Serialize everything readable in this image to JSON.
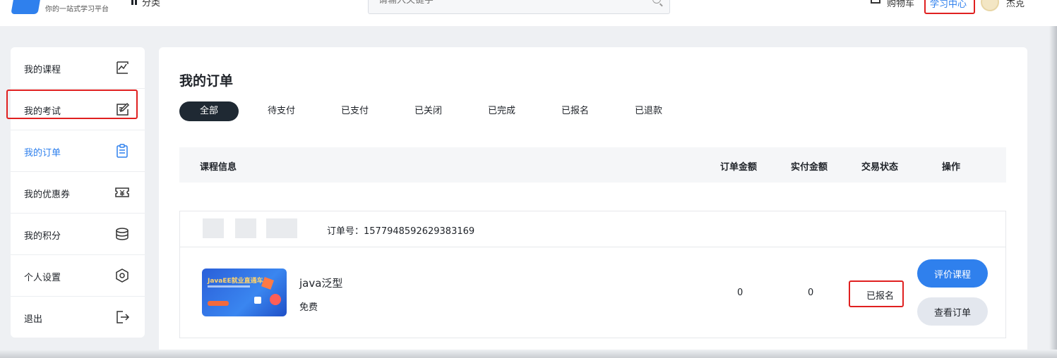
{
  "header": {
    "logo_tagline": "你的一站式学习平台",
    "category_label": "分类",
    "search_placeholder": "请输入关键字",
    "cart_label": "购物车",
    "study_center_label": "学习中心",
    "username": "杰克"
  },
  "sidebar": {
    "items": [
      {
        "label": "我的课程",
        "icon": "chart-icon"
      },
      {
        "label": "我的考试",
        "icon": "edit-icon"
      },
      {
        "label": "我的订单",
        "icon": "clipboard-icon"
      },
      {
        "label": "我的优惠券",
        "icon": "coupon-icon"
      },
      {
        "label": "我的积分",
        "icon": "coins-icon"
      },
      {
        "label": "个人设置",
        "icon": "settings-icon"
      },
      {
        "label": "退出",
        "icon": "logout-icon"
      }
    ],
    "active_index": 2
  },
  "main": {
    "title": "我的订单",
    "tabs": [
      "全部",
      "待支付",
      "已支付",
      "已关闭",
      "已完成",
      "已报名",
      "已退款"
    ],
    "active_tab": 0,
    "table_headers": {
      "course_info": "课程信息",
      "order_amount": "订单金额",
      "paid_amount": "实付金额",
      "trade_status": "交易状态",
      "actions": "操作"
    },
    "orders": [
      {
        "order_no_label": "订单号：1577948592629383169",
        "thumbnail_text": "JavaEE就业直通车",
        "course_name": "java泛型",
        "price_label": "免费",
        "order_amount": "0",
        "paid_amount": "0",
        "status": "已报名",
        "review_button": "评价课程",
        "view_button": "查看订单"
      }
    ]
  },
  "colors": {
    "accent": "#2f80ed",
    "highlight_border": "#e02020",
    "active_tab_bg": "#1f2933"
  }
}
